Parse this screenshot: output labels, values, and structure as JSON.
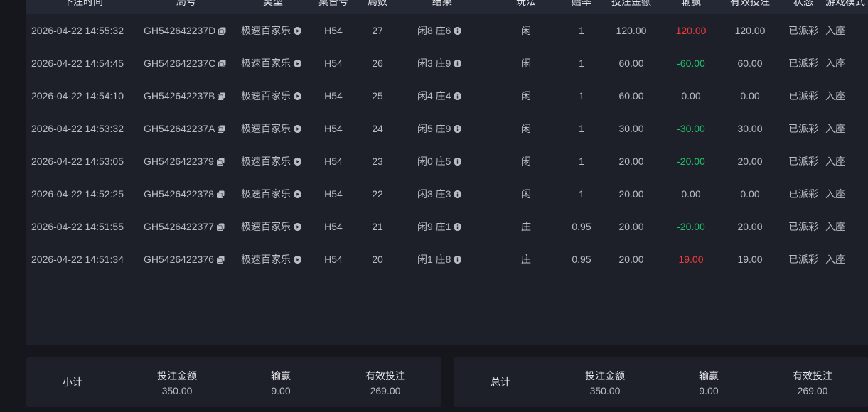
{
  "table": {
    "headers": [
      "下注时间",
      "局号",
      "类型",
      "桌台号",
      "局数",
      "结果",
      "玩法",
      "赔率",
      "投注金额",
      "输赢",
      "有效投注",
      "状态",
      "游戏模式"
    ],
    "rows": [
      {
        "time": "2026-04-22 14:55:32",
        "round_id": "GH542642237D",
        "type": "极速百家乐",
        "table": "H54",
        "round": "27",
        "result": "闲8 庄6",
        "play": "闲",
        "odds": "1",
        "bet": "120.00",
        "win": "120.00",
        "win_color": "red",
        "valid": "120.00",
        "status": "已派彩",
        "mode": "入座"
      },
      {
        "time": "2026-04-22 14:54:45",
        "round_id": "GH542642237C",
        "type": "极速百家乐",
        "table": "H54",
        "round": "26",
        "result": "闲3 庄9",
        "play": "闲",
        "odds": "1",
        "bet": "60.00",
        "win": "-60.00",
        "win_color": "green",
        "valid": "60.00",
        "status": "已派彩",
        "mode": "入座"
      },
      {
        "time": "2026-04-22 14:54:10",
        "round_id": "GH542642237B",
        "type": "极速百家乐",
        "table": "H54",
        "round": "25",
        "result": "闲4 庄4",
        "play": "闲",
        "odds": "1",
        "bet": "60.00",
        "win": "0.00",
        "win_color": "none",
        "valid": "0.00",
        "status": "已派彩",
        "mode": "入座"
      },
      {
        "time": "2026-04-22 14:53:32",
        "round_id": "GH542642237A",
        "type": "极速百家乐",
        "table": "H54",
        "round": "24",
        "result": "闲5 庄9",
        "play": "闲",
        "odds": "1",
        "bet": "30.00",
        "win": "-30.00",
        "win_color": "green",
        "valid": "30.00",
        "status": "已派彩",
        "mode": "入座"
      },
      {
        "time": "2026-04-22 14:53:05",
        "round_id": "GH5426422379",
        "type": "极速百家乐",
        "table": "H54",
        "round": "23",
        "result": "闲0 庄5",
        "play": "闲",
        "odds": "1",
        "bet": "20.00",
        "win": "-20.00",
        "win_color": "green",
        "valid": "20.00",
        "status": "已派彩",
        "mode": "入座"
      },
      {
        "time": "2026-04-22 14:52:25",
        "round_id": "GH5426422378",
        "type": "极速百家乐",
        "table": "H54",
        "round": "22",
        "result": "闲3 庄3",
        "play": "闲",
        "odds": "1",
        "bet": "20.00",
        "win": "0.00",
        "win_color": "none",
        "valid": "0.00",
        "status": "已派彩",
        "mode": "入座"
      },
      {
        "time": "2026-04-22 14:51:55",
        "round_id": "GH5426422377",
        "type": "极速百家乐",
        "table": "H54",
        "round": "21",
        "result": "闲9 庄1",
        "play": "庄",
        "odds": "0.95",
        "bet": "20.00",
        "win": "-20.00",
        "win_color": "green",
        "valid": "20.00",
        "status": "已派彩",
        "mode": "入座"
      },
      {
        "time": "2026-04-22 14:51:34",
        "round_id": "GH5426422376",
        "type": "极速百家乐",
        "table": "H54",
        "round": "20",
        "result": "闲1 庄8",
        "play": "庄",
        "odds": "0.95",
        "bet": "20.00",
        "win": "19.00",
        "win_color": "red",
        "valid": "19.00",
        "status": "已派彩",
        "mode": "入座"
      }
    ]
  },
  "subtotal": {
    "title": "小计",
    "bet_label": "投注金额",
    "bet_value": "350.00",
    "win_label": "输赢",
    "win_value": "9.00",
    "valid_label": "有效投注",
    "valid_value": "269.00"
  },
  "total": {
    "title": "总计",
    "bet_label": "投注金额",
    "bet_value": "350.00",
    "win_label": "输赢",
    "win_value": "9.00",
    "valid_label": "有效投注",
    "valid_value": "269.00"
  },
  "colors": {
    "win_positive": "#ef3b3b",
    "win_negative": "#1fc26a",
    "panel": "#1d2029",
    "header": "#242835"
  },
  "icons": {
    "copy": "copy-icon",
    "play": "play-icon",
    "info": "info-icon"
  }
}
